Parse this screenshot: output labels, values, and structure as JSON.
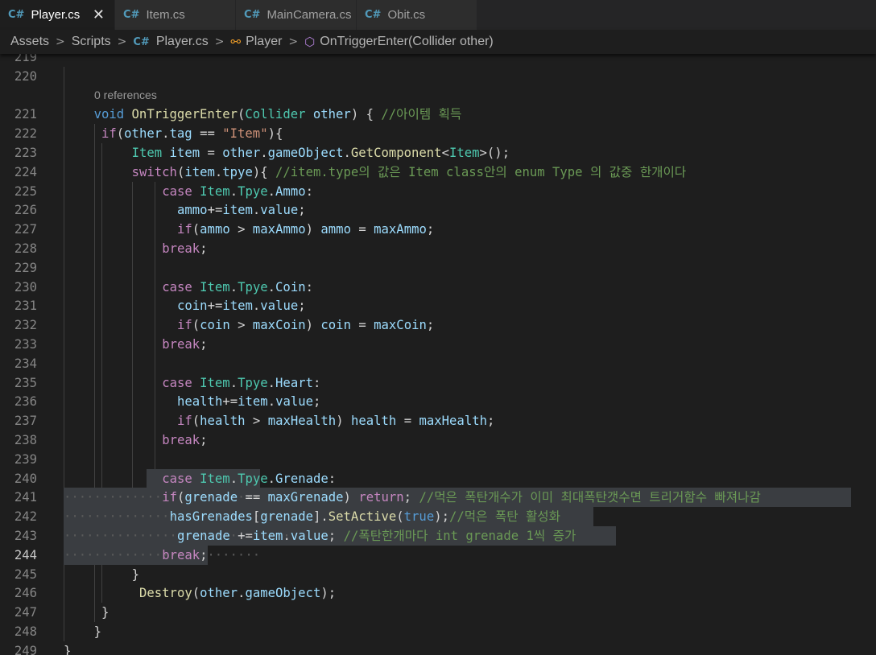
{
  "tabs": [
    {
      "label": "Player.cs",
      "active": true,
      "close": "✕"
    },
    {
      "label": "Item.cs"
    },
    {
      "label": "MainCamera.cs"
    },
    {
      "label": "Obit.cs"
    }
  ],
  "tab_icon": "C#",
  "breadcrumb": [
    "Assets",
    "Scripts",
    "Player.cs",
    "Player",
    "OnTriggerEnter(Collider other)"
  ],
  "codelens": "0 references",
  "lines": [
    {
      "n": "219",
      "indent": 0,
      "toks": []
    },
    {
      "n": "220",
      "indent": 0,
      "toks": []
    },
    {
      "n": "221",
      "indent": 4,
      "toks": [
        [
          "kw",
          "void"
        ],
        [
          "pl",
          " "
        ],
        [
          "fn",
          "OnTriggerEnter"
        ],
        [
          "pl",
          "("
        ],
        [
          "ty",
          "Collider"
        ],
        [
          "pl",
          " "
        ],
        [
          "va",
          "other"
        ],
        [
          "pl",
          ") { "
        ],
        [
          "cm",
          "//아이템 획득"
        ]
      ]
    },
    {
      "n": "222",
      "indent": 5,
      "toks": [
        [
          "ctl",
          "if"
        ],
        [
          "pl",
          "("
        ],
        [
          "va",
          "other"
        ],
        [
          "pl",
          "."
        ],
        [
          "va",
          "tag"
        ],
        [
          "pl",
          " == "
        ],
        [
          "str",
          "\"Item\""
        ],
        [
          "pl",
          "){"
        ]
      ]
    },
    {
      "n": "223",
      "indent": 9,
      "toks": [
        [
          "ty",
          "Item"
        ],
        [
          "pl",
          " "
        ],
        [
          "va",
          "item"
        ],
        [
          "pl",
          " = "
        ],
        [
          "va",
          "other"
        ],
        [
          "pl",
          "."
        ],
        [
          "va",
          "gameObject"
        ],
        [
          "pl",
          "."
        ],
        [
          "fn",
          "GetComponent"
        ],
        [
          "pl",
          "<"
        ],
        [
          "ty",
          "Item"
        ],
        [
          "pl",
          ">();"
        ]
      ]
    },
    {
      "n": "224",
      "indent": 9,
      "toks": [
        [
          "ctl",
          "switch"
        ],
        [
          "pl",
          "("
        ],
        [
          "va",
          "item"
        ],
        [
          "pl",
          "."
        ],
        [
          "va",
          "tpye"
        ],
        [
          "pl",
          "){ "
        ],
        [
          "cm",
          "//item.type의 값은 Item class안의 enum Type 의 값중 한개이다"
        ]
      ]
    },
    {
      "n": "225",
      "indent": 13,
      "toks": [
        [
          "ctl",
          "case"
        ],
        [
          "pl",
          " "
        ],
        [
          "ty",
          "Item"
        ],
        [
          "pl",
          "."
        ],
        [
          "ty",
          "Tpye"
        ],
        [
          "pl",
          "."
        ],
        [
          "va",
          "Ammo"
        ],
        [
          "pl",
          ":"
        ]
      ]
    },
    {
      "n": "226",
      "indent": 15,
      "toks": [
        [
          "va",
          "ammo"
        ],
        [
          "pl",
          "+="
        ],
        [
          "va",
          "item"
        ],
        [
          "pl",
          "."
        ],
        [
          "va",
          "value"
        ],
        [
          "pl",
          ";"
        ]
      ]
    },
    {
      "n": "227",
      "indent": 15,
      "toks": [
        [
          "ctl",
          "if"
        ],
        [
          "pl",
          "("
        ],
        [
          "va",
          "ammo"
        ],
        [
          "pl",
          " > "
        ],
        [
          "va",
          "maxAmmo"
        ],
        [
          "pl",
          ") "
        ],
        [
          "va",
          "ammo"
        ],
        [
          "pl",
          " = "
        ],
        [
          "va",
          "maxAmmo"
        ],
        [
          "pl",
          ";"
        ]
      ]
    },
    {
      "n": "228",
      "indent": 13,
      "toks": [
        [
          "ctl",
          "break"
        ],
        [
          "pl",
          ";"
        ]
      ]
    },
    {
      "n": "229",
      "indent": 0,
      "toks": []
    },
    {
      "n": "230",
      "indent": 13,
      "toks": [
        [
          "ctl",
          "case"
        ],
        [
          "pl",
          " "
        ],
        [
          "ty",
          "Item"
        ],
        [
          "pl",
          "."
        ],
        [
          "ty",
          "Tpye"
        ],
        [
          "pl",
          "."
        ],
        [
          "va",
          "Coin"
        ],
        [
          "pl",
          ":"
        ]
      ]
    },
    {
      "n": "231",
      "indent": 15,
      "toks": [
        [
          "va",
          "coin"
        ],
        [
          "pl",
          "+="
        ],
        [
          "va",
          "item"
        ],
        [
          "pl",
          "."
        ],
        [
          "va",
          "value"
        ],
        [
          "pl",
          ";"
        ]
      ]
    },
    {
      "n": "232",
      "indent": 15,
      "toks": [
        [
          "ctl",
          "if"
        ],
        [
          "pl",
          "("
        ],
        [
          "va",
          "coin"
        ],
        [
          "pl",
          " > "
        ],
        [
          "va",
          "maxCoin"
        ],
        [
          "pl",
          ") "
        ],
        [
          "va",
          "coin"
        ],
        [
          "pl",
          " = "
        ],
        [
          "va",
          "maxCoin"
        ],
        [
          "pl",
          ";"
        ]
      ]
    },
    {
      "n": "233",
      "indent": 13,
      "toks": [
        [
          "ctl",
          "break"
        ],
        [
          "pl",
          ";"
        ]
      ]
    },
    {
      "n": "234",
      "indent": 0,
      "toks": []
    },
    {
      "n": "235",
      "indent": 13,
      "toks": [
        [
          "ctl",
          "case"
        ],
        [
          "pl",
          " "
        ],
        [
          "ty",
          "Item"
        ],
        [
          "pl",
          "."
        ],
        [
          "ty",
          "Tpye"
        ],
        [
          "pl",
          "."
        ],
        [
          "va",
          "Heart"
        ],
        [
          "pl",
          ":"
        ]
      ]
    },
    {
      "n": "236",
      "indent": 15,
      "toks": [
        [
          "va",
          "health"
        ],
        [
          "pl",
          "+="
        ],
        [
          "va",
          "item"
        ],
        [
          "pl",
          "."
        ],
        [
          "va",
          "value"
        ],
        [
          "pl",
          ";"
        ]
      ]
    },
    {
      "n": "237",
      "indent": 15,
      "toks": [
        [
          "ctl",
          "if"
        ],
        [
          "pl",
          "("
        ],
        [
          "va",
          "health"
        ],
        [
          "pl",
          " > "
        ],
        [
          "va",
          "maxHealth"
        ],
        [
          "pl",
          ") "
        ],
        [
          "va",
          "health"
        ],
        [
          "pl",
          " = "
        ],
        [
          "va",
          "maxHealth"
        ],
        [
          "pl",
          ";"
        ]
      ]
    },
    {
      "n": "238",
      "indent": 13,
      "toks": [
        [
          "ctl",
          "break"
        ],
        [
          "pl",
          ";"
        ]
      ]
    },
    {
      "n": "239",
      "indent": 0,
      "toks": []
    },
    {
      "n": "240",
      "indent": 13,
      "toks": [
        [
          "ctl",
          "case"
        ],
        [
          "pl",
          " "
        ],
        [
          "ty",
          "Item"
        ],
        [
          "pl",
          "."
        ],
        [
          "ty",
          "Tpye"
        ],
        [
          "pl",
          "."
        ],
        [
          "va",
          "Grenade"
        ],
        [
          "pl",
          ":"
        ]
      ]
    },
    {
      "n": "241",
      "indent": 13,
      "toks": [
        [
          "ctl",
          "if"
        ],
        [
          "pl",
          "("
        ],
        [
          "va",
          "grenade"
        ],
        [
          "pl",
          " == "
        ],
        [
          "va",
          "maxGrenade"
        ],
        [
          "pl",
          ") "
        ],
        [
          "ctl",
          "return"
        ],
        [
          "pl",
          "; "
        ],
        [
          "cm",
          "//먹은 폭탄개수가 이미 최대폭탄갯수면 트리거함수 빠져나감"
        ]
      ]
    },
    {
      "n": "242",
      "indent": 14,
      "toks": [
        [
          "va",
          "hasGrenades"
        ],
        [
          "pl",
          "["
        ],
        [
          "va",
          "grenade"
        ],
        [
          "pl",
          "]."
        ],
        [
          "fn",
          "SetActive"
        ],
        [
          "pl",
          "("
        ],
        [
          "kw",
          "true"
        ],
        [
          "pl",
          ");"
        ],
        [
          "cm",
          "//먹은 폭탄 활성화"
        ]
      ]
    },
    {
      "n": "243",
      "indent": 15,
      "toks": [
        [
          "va",
          "grenade"
        ],
        [
          "pl",
          " +="
        ],
        [
          "va",
          "item"
        ],
        [
          "pl",
          "."
        ],
        [
          "va",
          "value"
        ],
        [
          "pl",
          "; "
        ],
        [
          "cm",
          "//폭탄한개마다 int grenade 1씩 증가"
        ]
      ]
    },
    {
      "n": "244",
      "indent": 13,
      "toks": [
        [
          "ctl",
          "break"
        ],
        [
          "pl",
          ";"
        ]
      ]
    },
    {
      "n": "245",
      "indent": 9,
      "toks": [
        [
          "pl",
          "}"
        ]
      ]
    },
    {
      "n": "246",
      "indent": 10,
      "toks": [
        [
          "fn",
          "Destroy"
        ],
        [
          "pl",
          "("
        ],
        [
          "va",
          "other"
        ],
        [
          "pl",
          "."
        ],
        [
          "va",
          "gameObject"
        ],
        [
          "pl",
          ");"
        ]
      ]
    },
    {
      "n": "247",
      "indent": 5,
      "toks": [
        [
          "pl",
          "}"
        ]
      ]
    },
    {
      "n": "248",
      "indent": 4,
      "toks": [
        [
          "pl",
          "}"
        ]
      ]
    },
    {
      "n": "249",
      "indent": 0,
      "toks": [
        [
          "pl",
          "}"
        ]
      ]
    }
  ],
  "current_line": "244",
  "colors": {
    "keyword": "#569cd6",
    "control": "#c586c0",
    "function": "#dcdcaa",
    "type": "#4ec9b0",
    "variable": "#9cdcfe",
    "string": "#ce9178",
    "comment": "#6a9955",
    "selection": "#3a3d41",
    "background": "#1e1e1e"
  }
}
